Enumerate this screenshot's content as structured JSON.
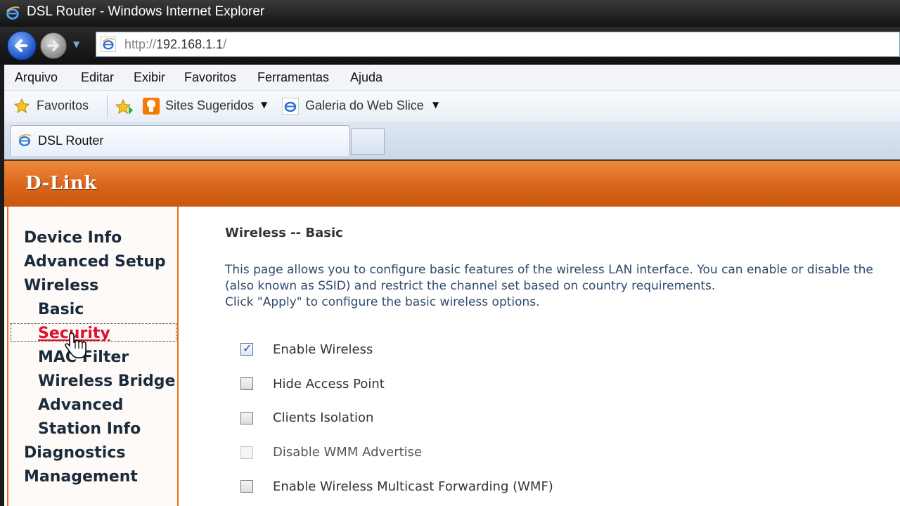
{
  "window": {
    "title": "DSL Router - Windows Internet Explorer"
  },
  "address_bar": {
    "protocol": "http://",
    "host": "192.168.1.1",
    "path": "/"
  },
  "menu": [
    "Arquivo",
    "Editar",
    "Exibir",
    "Favoritos",
    "Ferramentas",
    "Ajuda"
  ],
  "favorites_bar": {
    "favorites_label": "Favoritos",
    "suggested_sites": "Sites Sugeridos",
    "web_slice_gallery": "Galeria do Web Slice"
  },
  "tab": {
    "title": "DSL Router"
  },
  "brand": {
    "logo": "D-Link",
    "color": "#d9651b"
  },
  "sidebar": {
    "items": [
      {
        "label": "Device Info",
        "level": 0
      },
      {
        "label": "Advanced Setup",
        "level": 0
      },
      {
        "label": "Wireless",
        "level": 0
      },
      {
        "label": "Basic",
        "level": 1
      },
      {
        "label": "Security",
        "level": 1,
        "state": "hover"
      },
      {
        "label": "MAC Filter",
        "level": 1
      },
      {
        "label": "Wireless Bridge",
        "level": 1
      },
      {
        "label": "Advanced",
        "level": 1
      },
      {
        "label": "Station Info",
        "level": 1
      },
      {
        "label": "Diagnostics",
        "level": 0
      },
      {
        "label": "Management",
        "level": 0
      }
    ]
  },
  "content": {
    "heading": "Wireless -- Basic",
    "description": [
      "This page allows you to configure basic features of the wireless LAN interface. You can enable or disable the",
      "(also known as SSID) and restrict the channel set based on country requirements.",
      "Click \"Apply\" to configure the basic wireless options."
    ],
    "options": [
      {
        "label": "Enable Wireless",
        "checked": true,
        "disabled": false
      },
      {
        "label": "Hide Access Point",
        "checked": false,
        "disabled": false
      },
      {
        "label": "Clients Isolation",
        "checked": false,
        "disabled": false
      },
      {
        "label": "Disable WMM Advertise",
        "checked": false,
        "disabled": true
      },
      {
        "label": "Enable Wireless Multicast Forwarding (WMF)",
        "checked": false,
        "disabled": false
      }
    ]
  }
}
